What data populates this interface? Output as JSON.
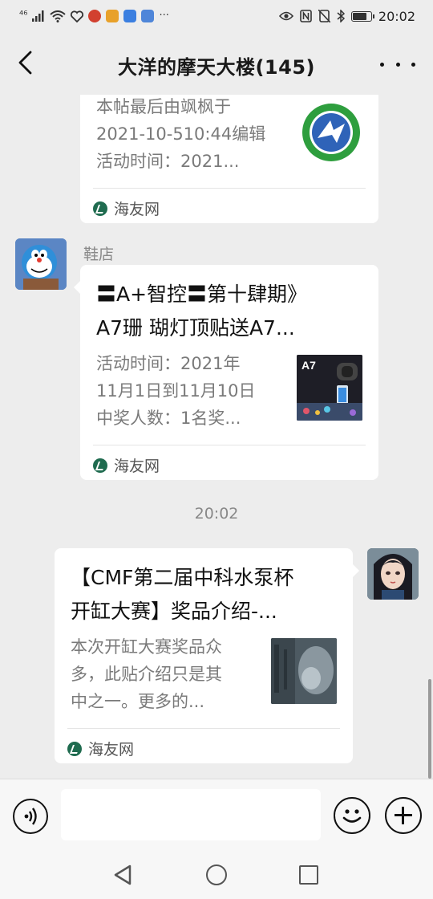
{
  "status_bar": {
    "signal": "⁴⁶",
    "time": "20:02",
    "battery_level": 0.8,
    "app_icon_colors": [
      "#d2402f",
      "#e8a12a",
      "#3b7fe0",
      "#4f86d9"
    ],
    "more_glyph": "···"
  },
  "header": {
    "title": "大洋的摩天大楼(145)"
  },
  "messages": [
    {
      "desc_lines": [
        "本帖最后由飒枫于",
        "2021-10-510:44编辑",
        "活动时间：2021..."
      ],
      "source": "海友网",
      "thumb": "green-fish-logo"
    },
    {
      "sender": "鞋店",
      "title_lines": [
        "〓A+智控〓第十肆期》",
        "A7珊 瑚灯顶贴送A7..."
      ],
      "desc_lines": [
        "活动时间：2021年",
        "11月1日到11月10日",
        "中奖人数：1名奖..."
      ],
      "thumb_label": "A7",
      "source": "海友网"
    },
    {
      "timestamp": "20:02"
    },
    {
      "title_lines": [
        "【CMF第二届中科水泵杯",
        "开缸大赛】奖品介绍-..."
      ],
      "desc_lines": [
        "本次开缸大赛奖品众",
        "多，此贴介绍只是其",
        "中之一。更多的..."
      ],
      "source": "海友网",
      "thumb": "aquarium-photo"
    }
  ],
  "input": {
    "placeholder": ""
  },
  "colors": {
    "background": "#ededed",
    "bubble": "#ffffff",
    "source_icon": "#1f6b4f",
    "logo_green": "#2e9e3e"
  }
}
